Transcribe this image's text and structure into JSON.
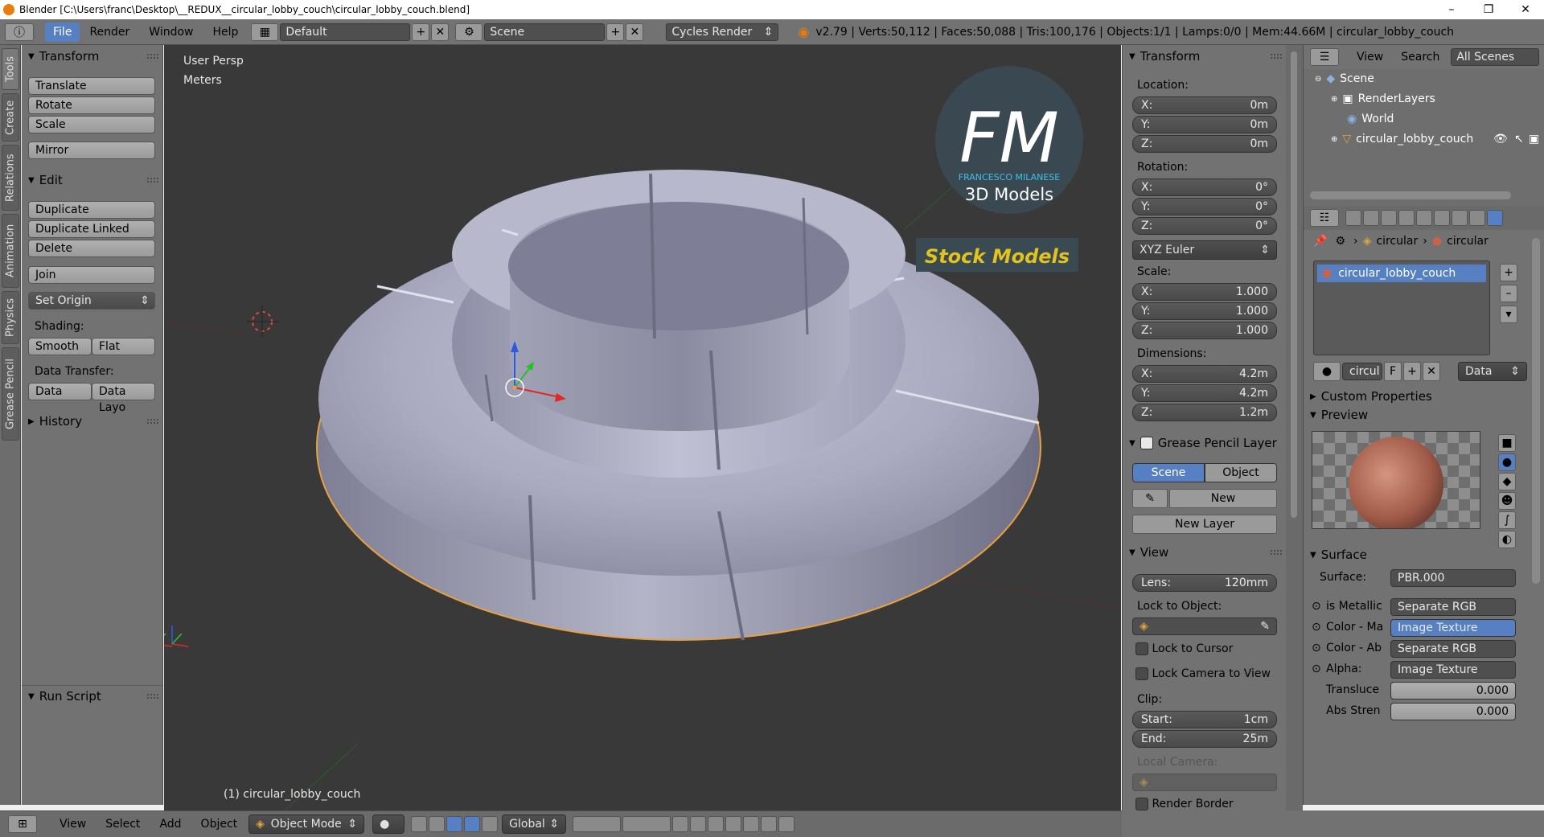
{
  "window": {
    "title": "Blender [C:\\Users\\franc\\Desktop\\__REDUX__circular_lobby_couch\\circular_lobby_couch.blend]",
    "minimize": "–",
    "maximize": "❐",
    "close": "✕"
  },
  "topbar": {
    "menus": [
      "File",
      "Render",
      "Window",
      "Help"
    ],
    "layout": "Default",
    "scene": "Scene",
    "engine": "Cycles Render",
    "stats": "v2.79 | Verts:50,112 | Faces:50,088 | Tris:100,176 | Objects:1/1 | Lamps:0/0 | Mem:44.66M | circular_lobby_couch"
  },
  "left_tabs": [
    "Tools",
    "Create",
    "Relations",
    "Animation",
    "Physics",
    "Grease Pencil"
  ],
  "toolshelf": {
    "transform_title": "Transform",
    "translate": "Translate",
    "rotate": "Rotate",
    "scale": "Scale",
    "mirror": "Mirror",
    "edit_title": "Edit",
    "duplicate": "Duplicate",
    "duplicate_linked": "Duplicate Linked",
    "delete": "Delete",
    "join": "Join",
    "set_origin": "Set Origin",
    "shading_label": "Shading:",
    "smooth": "Smooth",
    "flat": "Flat",
    "data_transfer_label": "Data Transfer:",
    "data": "Data",
    "data_layout": "Data Layo",
    "history_title": "History",
    "run_script_title": "Run Script"
  },
  "viewport": {
    "view_name": "User Persp",
    "units": "Meters",
    "object_label": "(1) circular_lobby_couch",
    "logo_letters": "FM",
    "logo_name": "FRANCESCO MILANESE",
    "logo_sub": "3D Models",
    "stock_label": "Stock Models",
    "colors": {
      "bg": "#393939",
      "couch": "#9e9eb6",
      "outline": "#e8a040",
      "stock": "#e2c21e"
    }
  },
  "nprops": {
    "transform_title": "Transform",
    "location_label": "Location:",
    "location": [
      {
        "k": "X:",
        "v": "0m"
      },
      {
        "k": "Y:",
        "v": "0m"
      },
      {
        "k": "Z:",
        "v": "0m"
      }
    ],
    "rotation_label": "Rotation:",
    "rotation": [
      {
        "k": "X:",
        "v": "0°"
      },
      {
        "k": "Y:",
        "v": "0°"
      },
      {
        "k": "Z:",
        "v": "0°"
      }
    ],
    "rotation_mode": "XYZ Euler",
    "scale_label": "Scale:",
    "scale": [
      {
        "k": "X:",
        "v": "1.000"
      },
      {
        "k": "Y:",
        "v": "1.000"
      },
      {
        "k": "Z:",
        "v": "1.000"
      }
    ],
    "dimensions_label": "Dimensions:",
    "dimensions": [
      {
        "k": "X:",
        "v": "4.2m"
      },
      {
        "k": "Y:",
        "v": "4.2m"
      },
      {
        "k": "Z:",
        "v": "1.2m"
      }
    ],
    "gp_title": "Grease Pencil Layer",
    "gp_scene": "Scene",
    "gp_object": "Object",
    "gp_new": "New",
    "gp_new_layer": "New Layer",
    "view_title": "View",
    "lens_k": "Lens:",
    "lens_v": "120mm",
    "lock_object_label": "Lock to Object:",
    "lock_cursor": "Lock to Cursor",
    "lock_camera": "Lock Camera to View",
    "clip_label": "Clip:",
    "clip_start_k": "Start:",
    "clip_start_v": "1cm",
    "clip_end_k": "End:",
    "clip_end_v": "25m",
    "local_camera_label": "Local Camera:",
    "render_border": "Render Border"
  },
  "outliner": {
    "view": "View",
    "search": "Search",
    "filter": "All Scenes",
    "items": [
      "Scene",
      "RenderLayers",
      "World",
      "circular_lobby_couch"
    ]
  },
  "properties": {
    "breadcrumb1": "circular",
    "breadcrumb2": "circular",
    "material_slot": "circular_lobby_couch",
    "mat_name": "circul",
    "mat_f": "F",
    "mat_data": "Data",
    "custom_props_title": "Custom Properties",
    "preview_title": "Preview",
    "surface_title": "Surface",
    "surface_label": "Surface:",
    "surface_value": "PBR.000",
    "rows": [
      {
        "k": "is Metallic",
        "v": "Separate RGB"
      },
      {
        "k": "Color - Ma",
        "v": "Image Texture"
      },
      {
        "k": "Color - Ab",
        "v": "Separate RGB"
      },
      {
        "k": "Alpha:",
        "v": "Image Texture"
      }
    ],
    "translucent_k": "Transluce",
    "translucent_v": "0.000",
    "abs_k": "Abs Stren",
    "abs_v": "0.000"
  },
  "bottombar": {
    "view": "View",
    "select": "Select",
    "add": "Add",
    "object": "Object",
    "mode": "Object Mode",
    "orientation": "Global"
  }
}
